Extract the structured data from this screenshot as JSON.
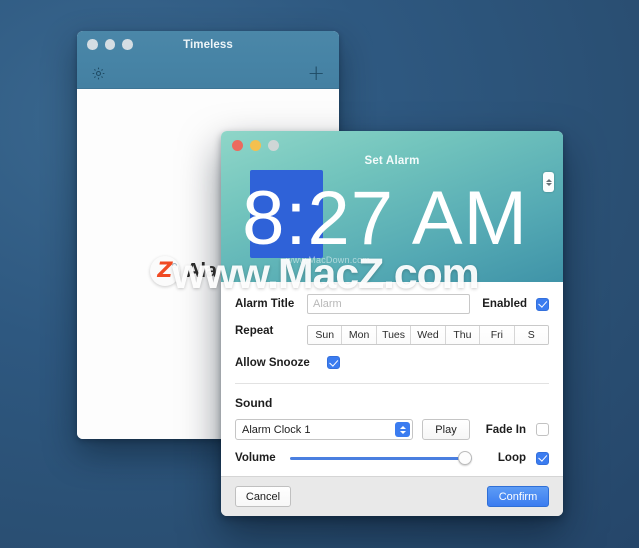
{
  "desktop": {
    "background_color": "#2e5880"
  },
  "timeless_window": {
    "title": "Timeless",
    "toolbar": {
      "settings_icon": "gear-icon",
      "add_icon": "plus-icon",
      "add_label": "+"
    }
  },
  "watermark": {
    "primary": "www.MacZ.com",
    "secondary": "www.MacDown.com",
    "ghost_text": "Ala",
    "logo_letter": "Z"
  },
  "dialog": {
    "title": "Set Alarm",
    "time": {
      "hour": "8",
      "separator": ":",
      "minute": "27",
      "meridiem": "AM",
      "display": "8:27 AM",
      "selected_field": "hour",
      "highlight_color": "#2f62d8"
    },
    "alarm_title": {
      "label": "Alarm Title",
      "value": "",
      "placeholder": "Alarm"
    },
    "enabled": {
      "label": "Enabled",
      "checked": true
    },
    "repeat": {
      "label": "Repeat",
      "days": [
        "Sun",
        "Mon",
        "Tues",
        "Wed",
        "Thu",
        "Fri",
        "S"
      ]
    },
    "allow_snooze": {
      "label": "Allow Snooze",
      "checked": true
    },
    "sound": {
      "heading": "Sound",
      "selected": "Alarm Clock 1",
      "options": [
        "Alarm Clock 1"
      ],
      "play_label": "Play",
      "fade_in": {
        "label": "Fade In",
        "checked": false
      },
      "loop": {
        "label": "Loop",
        "checked": true
      }
    },
    "volume": {
      "label": "Volume",
      "value": 100
    },
    "footer": {
      "cancel_label": "Cancel",
      "confirm_label": "Confirm"
    }
  }
}
